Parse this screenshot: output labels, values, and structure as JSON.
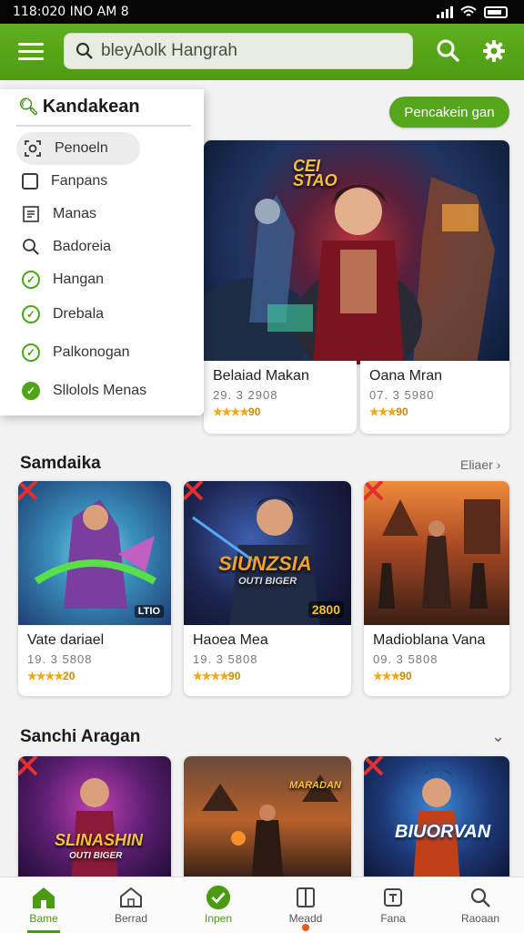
{
  "status_bar": {
    "time": "118:020 INO AM 8"
  },
  "app_bar": {
    "menu_icon": "hamburger-icon",
    "search_placeholder": "bleyAolk Hangrah",
    "search_icon": "search-icon",
    "settings_icon": "gear-icon",
    "accent_color": "#55a61a"
  },
  "dropdown": {
    "title": "Kandakean",
    "items": [
      {
        "label": "Penoeln",
        "icon": "scan-icon"
      },
      {
        "label": "Fanpans",
        "icon": "checkbox-icon"
      },
      {
        "label": "Manas",
        "icon": "list-icon"
      },
      {
        "label": "Badoreia",
        "icon": "search-icon"
      },
      {
        "label": "Hangan",
        "icon": "check-circle-icon"
      },
      {
        "label": "Drebala",
        "icon": "check-circle-icon"
      },
      {
        "label": "Palkonogan",
        "icon": "check-circle-icon"
      },
      {
        "label": "Sllolols Menas",
        "icon": "check-circle-filled-icon"
      }
    ]
  },
  "primary_button": {
    "label": "Pencakein gan"
  },
  "featured": {
    "hero_text": "CEI STAO",
    "cards": [
      {
        "title": "Belaiad Makan",
        "meta": "29. 3 2908",
        "rating": "90"
      },
      {
        "title": "Oana Mran",
        "meta": "07. 3 5980",
        "rating": "90"
      }
    ]
  },
  "section1": {
    "title": "Samdaika",
    "see_all": "Eliaer",
    "cards": [
      {
        "title": "Vate dariael",
        "meta": "19. 3 5808",
        "rating": "20",
        "art_badge": "LTIO"
      },
      {
        "title": "Haoea Mea",
        "meta": "19. 3 5808",
        "rating": "90",
        "art_text": "SIUNZSIA",
        "art_sub": "OUTI BIGER",
        "art_badge": "2800"
      },
      {
        "title": "Madioblana Vana",
        "meta": "09. 3 5808",
        "rating": "90"
      }
    ]
  },
  "section2": {
    "title": "Sanchi Aragan",
    "cards": [
      {
        "art_text": "SLINASHIN",
        "art_sub": "OUTI BIGER"
      },
      {
        "art_text": "MARADAN"
      },
      {
        "art_text": "BIUORVAN"
      }
    ]
  },
  "bottom_nav": [
    {
      "label": "Bame",
      "icon": "home-icon"
    },
    {
      "label": "Berrad",
      "icon": "house-outline-icon"
    },
    {
      "label": "Inpen",
      "icon": "check-circle-icon"
    },
    {
      "label": "Meadd",
      "icon": "book-icon"
    },
    {
      "label": "Fana",
      "icon": "tag-icon"
    },
    {
      "label": "Raoaan",
      "icon": "search-icon"
    }
  ]
}
